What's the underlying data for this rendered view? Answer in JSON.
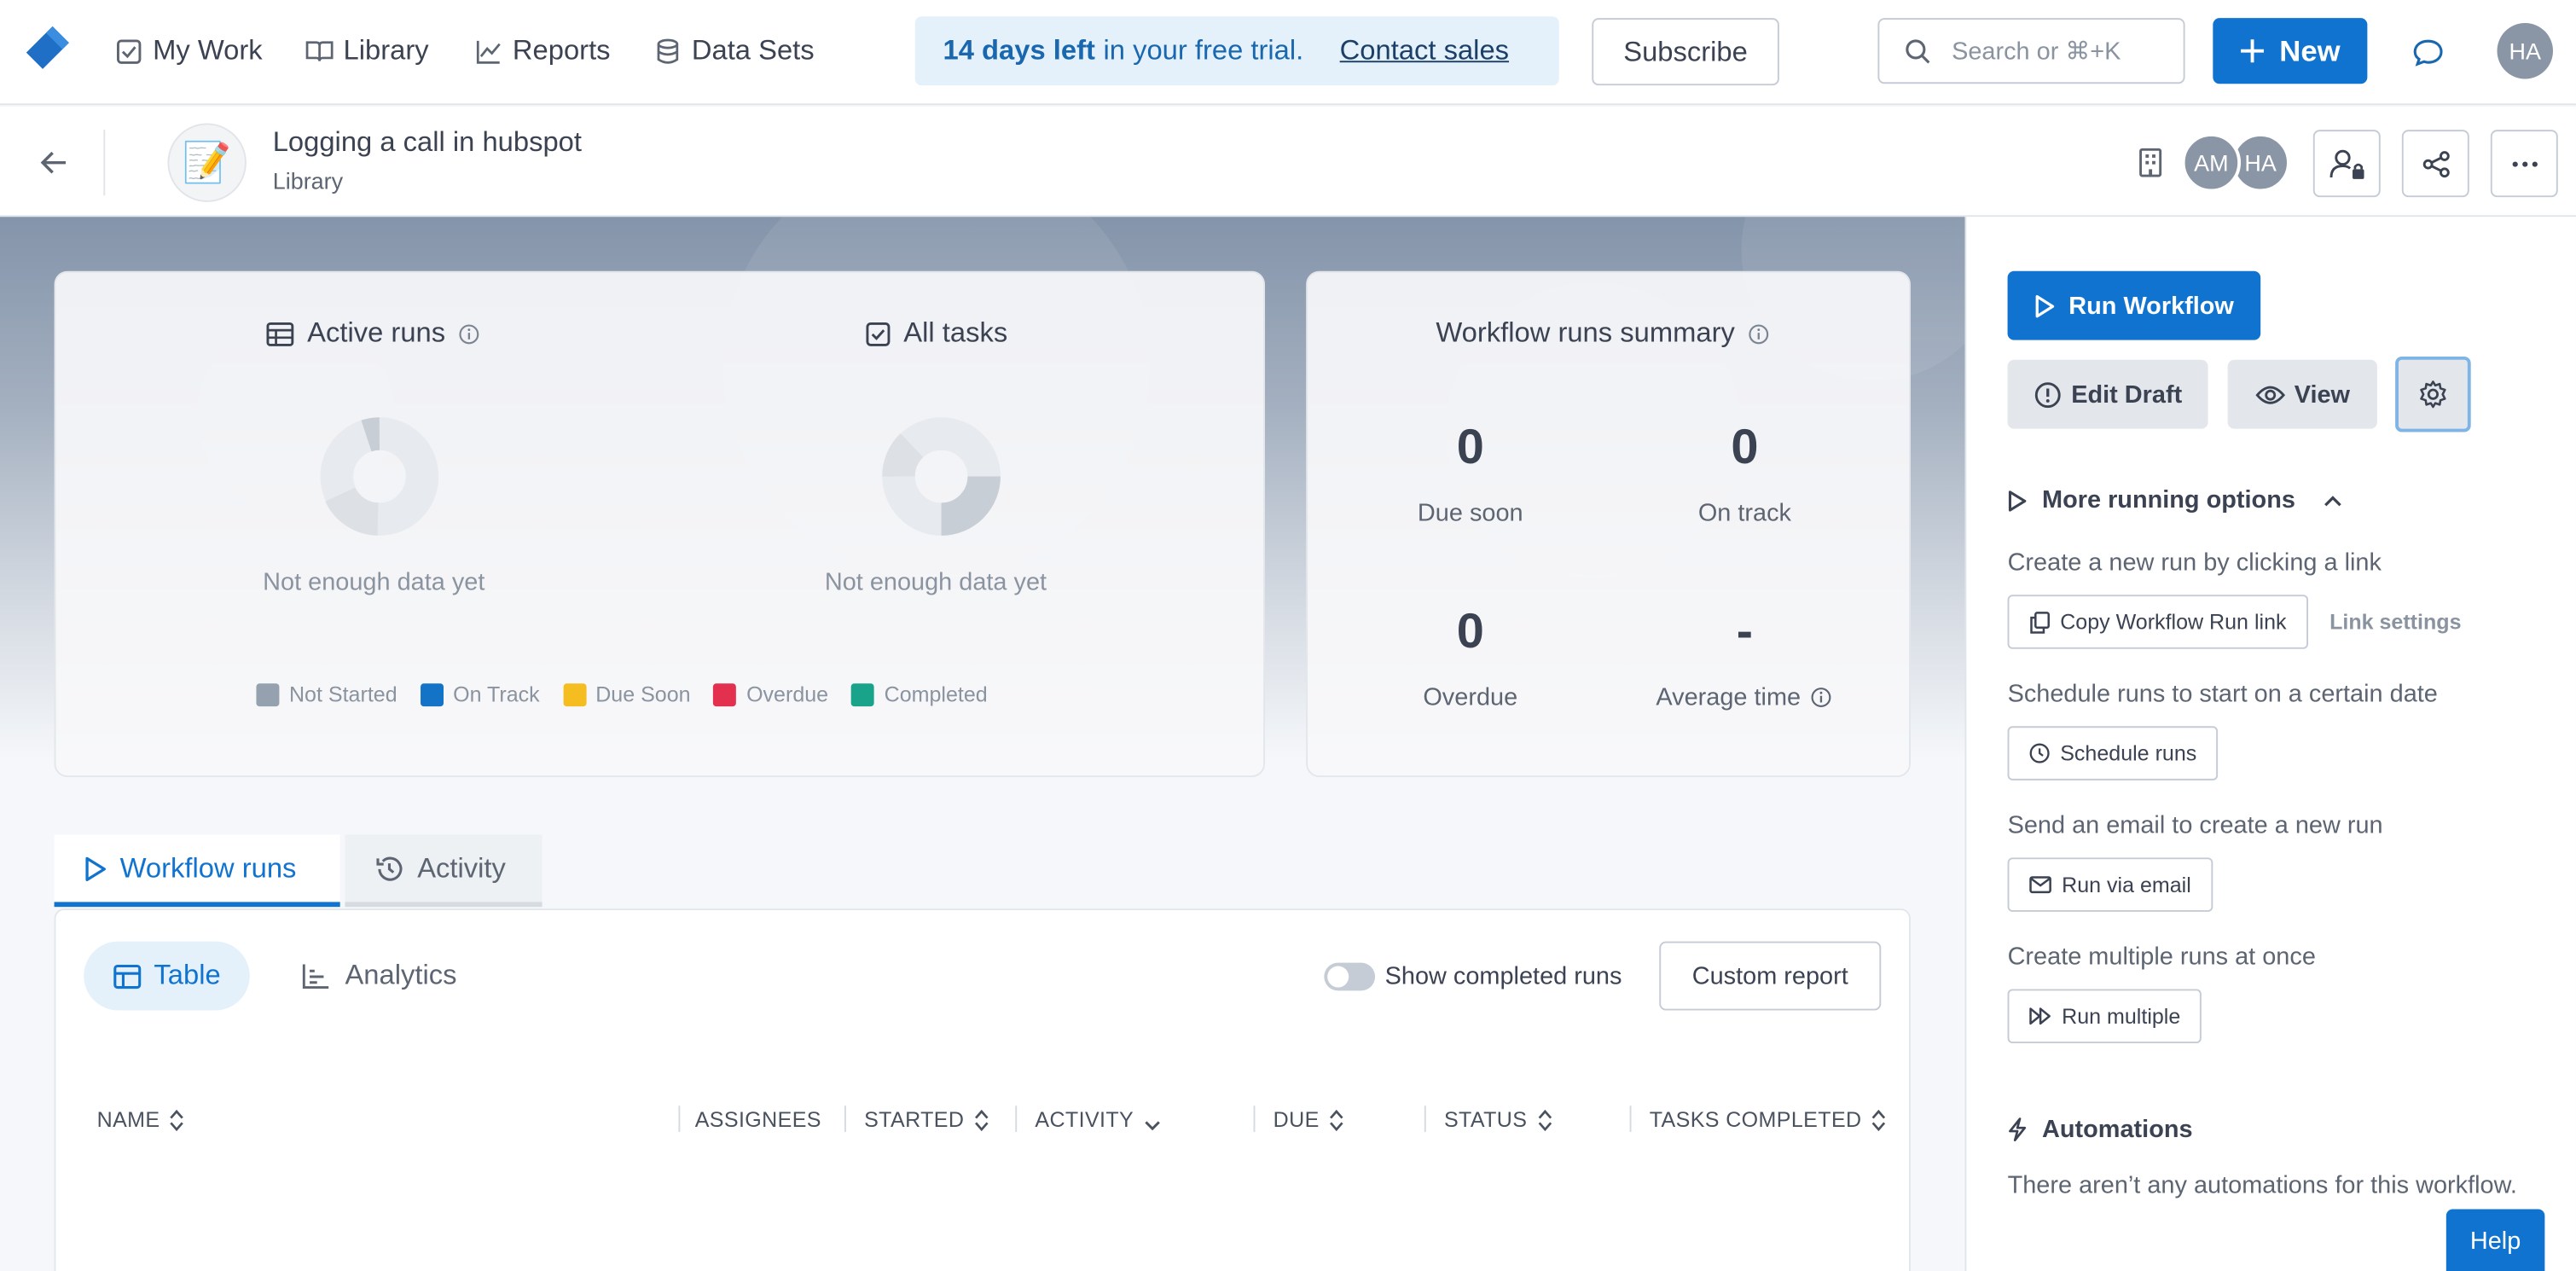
{
  "nav": {
    "items": [
      {
        "label": "My Work",
        "icon": "checkbox-icon"
      },
      {
        "label": "Library",
        "icon": "book-icon"
      },
      {
        "label": "Reports",
        "icon": "chart-line-icon"
      },
      {
        "label": "Data Sets",
        "icon": "database-icon"
      }
    ],
    "trial_bold": "14 days left",
    "trial_text": "in your free trial.",
    "trial_link": "Contact sales",
    "subscribe": "Subscribe",
    "search_placeholder": "Search or ⌘+K",
    "new_label": "New",
    "user_initials": "HA"
  },
  "header": {
    "title": "Logging a call in hubspot",
    "breadcrumb": "Library",
    "emoji": "📝",
    "avatars": [
      "AM",
      "HA"
    ]
  },
  "overview": {
    "active_runs": "Active runs",
    "all_tasks": "All tasks",
    "no_data": "Not enough data yet",
    "legend": [
      {
        "label": "Not Started",
        "color": "#95a1ae"
      },
      {
        "label": "On Track",
        "color": "#1373c7"
      },
      {
        "label": "Due Soon",
        "color": "#f5bd1f"
      },
      {
        "label": "Overdue",
        "color": "#e3304f"
      },
      {
        "label": "Completed",
        "color": "#1aa38b"
      }
    ]
  },
  "summary": {
    "title": "Workflow runs summary",
    "due_soon": {
      "value": "0",
      "label": "Due soon"
    },
    "on_track": {
      "value": "0",
      "label": "On track"
    },
    "overdue": {
      "value": "0",
      "label": "Overdue"
    },
    "average_time": {
      "value": "-",
      "label": "Average time"
    }
  },
  "tabs": {
    "workflow_runs": "Workflow runs",
    "activity": "Activity"
  },
  "table": {
    "view_table": "Table",
    "view_analytics": "Analytics",
    "show_completed": "Show completed runs",
    "custom_report": "Custom report",
    "columns": [
      "NAME",
      "ASSIGNEES",
      "STARTED",
      "ACTIVITY",
      "DUE",
      "STATUS",
      "TASKS COMPLETED"
    ]
  },
  "sidebar": {
    "run_workflow": "Run Workflow",
    "edit_draft": "Edit Draft",
    "view": "View",
    "more_options": "More running options",
    "link_text": "Create a new run by clicking a link",
    "copy_link": "Copy Workflow Run link",
    "link_settings": "Link settings",
    "schedule_text": "Schedule runs to start on a certain date",
    "schedule_btn": "Schedule runs",
    "email_text": "Send an email to create a new run",
    "email_btn": "Run via email",
    "multiple_text": "Create multiple runs at once",
    "multiple_btn": "Run multiple",
    "automations_title": "Automations",
    "automations_text": "There aren’t any automations for this workflow.",
    "help": "Help"
  },
  "colors": {
    "brand": "#0f73cf",
    "trial_bg": "#e4f1fb"
  }
}
